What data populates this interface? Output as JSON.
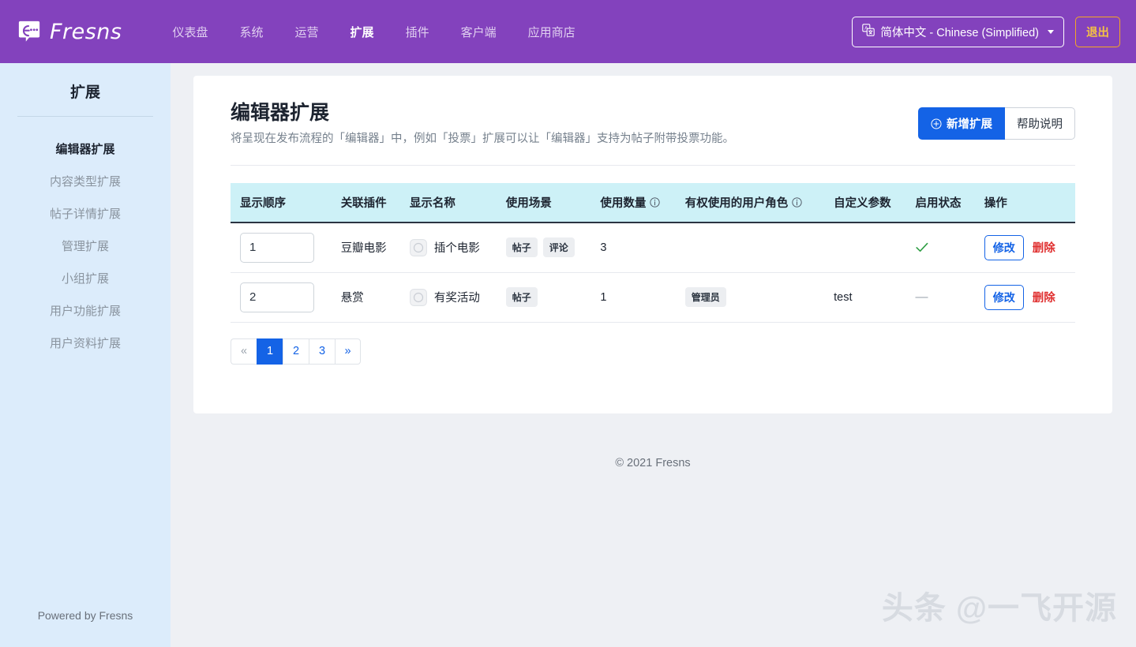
{
  "navbar": {
    "brand": "Fresns",
    "brand_icon": "fresns-speech-bubble-logo",
    "links": [
      {
        "label": "仪表盘",
        "active": false
      },
      {
        "label": "系统",
        "active": false
      },
      {
        "label": "运营",
        "active": false
      },
      {
        "label": "扩展",
        "active": true
      },
      {
        "label": "插件",
        "active": false
      },
      {
        "label": "客户端",
        "active": false
      },
      {
        "label": "应用商店",
        "active": false
      }
    ],
    "language": {
      "icon": "translate-icon",
      "label": "简体中文 - Chinese (Simplified)"
    },
    "logout_label": "退出"
  },
  "sidebar": {
    "title": "扩展",
    "items": [
      {
        "label": "编辑器扩展",
        "active": true
      },
      {
        "label": "内容类型扩展",
        "active": false
      },
      {
        "label": "帖子详情扩展",
        "active": false
      },
      {
        "label": "管理扩展",
        "active": false
      },
      {
        "label": "小组扩展",
        "active": false
      },
      {
        "label": "用户功能扩展",
        "active": false
      },
      {
        "label": "用户资料扩展",
        "active": false
      }
    ],
    "powered_by": "Powered by Fresns"
  },
  "page": {
    "title": "编辑器扩展",
    "subtitle": "将呈现在发布流程的「编辑器」中，例如「投票」扩展可以让「编辑器」支持为帖子附带投票功能。",
    "add_button": "新增扩展",
    "help_button": "帮助说明"
  },
  "table": {
    "columns": [
      {
        "label": "显示顺序",
        "info": false
      },
      {
        "label": "关联插件",
        "info": false
      },
      {
        "label": "显示名称",
        "info": false
      },
      {
        "label": "使用场景",
        "info": false
      },
      {
        "label": "使用数量",
        "info": true
      },
      {
        "label": "有权使用的用户角色",
        "info": true
      },
      {
        "label": "自定义参数",
        "info": false
      },
      {
        "label": "启用状态",
        "info": false
      },
      {
        "label": "操作",
        "info": false
      }
    ],
    "rows": [
      {
        "order": "1",
        "plugin": "豆瓣电影",
        "display_name": "插个电影",
        "scenes": [
          "帖子",
          "评论"
        ],
        "usage_count": "3",
        "roles": [],
        "custom_param": "",
        "enabled": true,
        "enabled_symbol": "✓",
        "edit_label": "修改",
        "delete_label": "删除"
      },
      {
        "order": "2",
        "plugin": "悬赏",
        "display_name": "有奖活动",
        "scenes": [
          "帖子"
        ],
        "usage_count": "1",
        "roles": [
          "管理员"
        ],
        "custom_param": "test",
        "enabled": false,
        "enabled_symbol": "—",
        "edit_label": "修改",
        "delete_label": "删除"
      }
    ]
  },
  "pagination": {
    "prev": "«",
    "next": "»",
    "pages": [
      "1",
      "2",
      "3"
    ],
    "current": "1"
  },
  "footer": {
    "copyright": "© 2021 Fresns"
  },
  "watermark": "头条 @一飞开源",
  "colors": {
    "navbar": "#8342bd",
    "primary": "#1463e6",
    "sidebar": "#dcecfb",
    "table_header": "#cdf1f7",
    "danger": "#e03131",
    "logout": "#f5c343",
    "success": "#2f9e44"
  }
}
